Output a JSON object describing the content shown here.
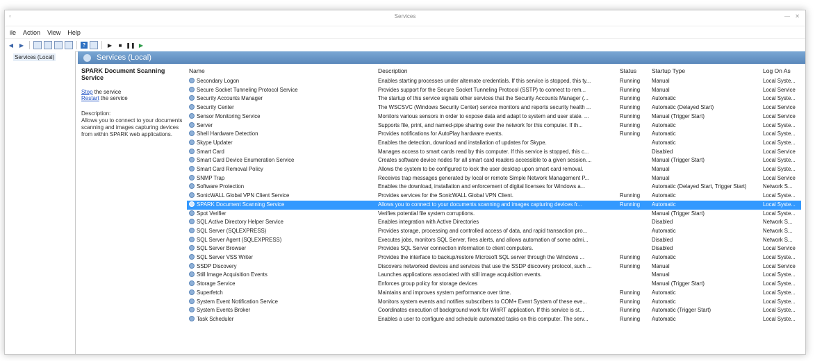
{
  "window": {
    "title": "Services"
  },
  "menu": [
    "ile",
    "Action",
    "View",
    "Help"
  ],
  "tree": {
    "root": "Services (Local)"
  },
  "header": {
    "title": "Services (Local)"
  },
  "extended": {
    "service_name": "SPARK Document Scanning Service",
    "stop_link": "Stop",
    "stop_rest": " the service",
    "restart_link": "Restart",
    "restart_rest": " the service",
    "description_label": "Description:",
    "description": "Allows you to connect to your documents scanning and images capturing devices from within SPARK web applications."
  },
  "columns": {
    "name": "Name",
    "description": "Description",
    "status": "Status",
    "startup": "Startup Type",
    "logon": "Log On As"
  },
  "services": [
    {
      "name": "Secondary Logon",
      "description": "Enables starting processes under alternate credentials. If this service is stopped, this ty...",
      "status": "Running",
      "startup": "Manual",
      "logon": "Local Syste..."
    },
    {
      "name": "Secure Socket Tunneling Protocol Service",
      "description": "Provides support for the Secure Socket Tunneling Protocol (SSTP) to connect to rem...",
      "status": "Running",
      "startup": "Manual",
      "logon": "Local Service"
    },
    {
      "name": "Security Accounts Manager",
      "description": "The startup of this service signals other services that the Security Accounts Manager (...",
      "status": "Running",
      "startup": "Automatic",
      "logon": "Local Syste..."
    },
    {
      "name": "Security Center",
      "description": "The WSCSVC (Windows Security Center) service monitors and reports security health ...",
      "status": "Running",
      "startup": "Automatic (Delayed Start)",
      "logon": "Local Service"
    },
    {
      "name": "Sensor Monitoring Service",
      "description": "Monitors various sensors in order to expose data and adapt to system and user state. ...",
      "status": "Running",
      "startup": "Manual (Trigger Start)",
      "logon": "Local Service"
    },
    {
      "name": "Server",
      "description": "Supports file, print, and named-pipe sharing over the network for this computer. If th...",
      "status": "Running",
      "startup": "Automatic",
      "logon": "Local Syste..."
    },
    {
      "name": "Shell Hardware Detection",
      "description": "Provides notifications for AutoPlay hardware events.",
      "status": "Running",
      "startup": "Automatic",
      "logon": "Local Syste..."
    },
    {
      "name": "Skype Updater",
      "description": "Enables the detection, download and installation of updates for Skype.",
      "status": "",
      "startup": "Automatic",
      "logon": "Local Syste..."
    },
    {
      "name": "Smart Card",
      "description": "Manages access to smart cards read by this computer. If this service is stopped, this c...",
      "status": "",
      "startup": "Disabled",
      "logon": "Local Service"
    },
    {
      "name": "Smart Card Device Enumeration Service",
      "description": "Creates software device nodes for all smart card readers accessible to a given session....",
      "status": "",
      "startup": "Manual (Trigger Start)",
      "logon": "Local Syste..."
    },
    {
      "name": "Smart Card Removal Policy",
      "description": "Allows the system to be configured to lock the user desktop upon smart card removal.",
      "status": "",
      "startup": "Manual",
      "logon": "Local Syste..."
    },
    {
      "name": "SNMP Trap",
      "description": "Receives trap messages generated by local or remote Simple Network Management P...",
      "status": "",
      "startup": "Manual",
      "logon": "Local Service"
    },
    {
      "name": "Software Protection",
      "description": "Enables the download, installation and enforcement of digital licenses for Windows a...",
      "status": "",
      "startup": "Automatic (Delayed Start, Trigger Start)",
      "logon": "Network S..."
    },
    {
      "name": "SonicWALL Global VPN Client Service",
      "description": "Provides services for the SonicWALL Global VPN Client.",
      "status": "Running",
      "startup": "Automatic",
      "logon": "Local Syste..."
    },
    {
      "name": "SPARK Document Scanning Service",
      "description": "Allows you to connect to your documents scanning and images capturing devices fr...",
      "status": "Running",
      "startup": "Automatic",
      "logon": "Local Syste...",
      "selected": true
    },
    {
      "name": "Spot Verifier",
      "description": "Verifies potential file system corruptions.",
      "status": "",
      "startup": "Manual (Trigger Start)",
      "logon": "Local Syste..."
    },
    {
      "name": "SQL Active Directory Helper Service",
      "description": "Enables integration with Active Directories",
      "status": "",
      "startup": "Disabled",
      "logon": "Network S..."
    },
    {
      "name": "SQL Server (SQLEXPRESS)",
      "description": "Provides storage, processing and controlled access of data, and rapid transaction pro...",
      "status": "",
      "startup": "Automatic",
      "logon": "Network S..."
    },
    {
      "name": "SQL Server Agent (SQLEXPRESS)",
      "description": "Executes jobs, monitors SQL Server, fires alerts, and allows automation of some admi...",
      "status": "",
      "startup": "Disabled",
      "logon": "Network S..."
    },
    {
      "name": "SQL Server Browser",
      "description": "Provides SQL Server connection information to client computers.",
      "status": "",
      "startup": "Disabled",
      "logon": "Local Service"
    },
    {
      "name": "SQL Server VSS Writer",
      "description": "Provides the interface to backup/restore Microsoft SQL server through the Windows ...",
      "status": "Running",
      "startup": "Automatic",
      "logon": "Local Syste..."
    },
    {
      "name": "SSDP Discovery",
      "description": "Discovers networked devices and services that use the SSDP discovery protocol, such ...",
      "status": "Running",
      "startup": "Manual",
      "logon": "Local Service"
    },
    {
      "name": "Still Image Acquisition Events",
      "description": "Launches applications associated with still image acquisition events.",
      "status": "",
      "startup": "Manual",
      "logon": "Local Syste..."
    },
    {
      "name": "Storage Service",
      "description": "Enforces group policy for storage devices",
      "status": "",
      "startup": "Manual (Trigger Start)",
      "logon": "Local Syste..."
    },
    {
      "name": "Superfetch",
      "description": "Maintains and improves system performance over time.",
      "status": "Running",
      "startup": "Automatic",
      "logon": "Local Syste..."
    },
    {
      "name": "System Event Notification Service",
      "description": "Monitors system events and notifies subscribers to COM+ Event System of these eve...",
      "status": "Running",
      "startup": "Automatic",
      "logon": "Local Syste..."
    },
    {
      "name": "System Events Broker",
      "description": "Coordinates execution of background work for WinRT application. If this service is st...",
      "status": "Running",
      "startup": "Automatic (Trigger Start)",
      "logon": "Local Syste..."
    },
    {
      "name": "Task Scheduler",
      "description": "Enables a user to configure and schedule automated tasks on this computer. The serv...",
      "status": "Running",
      "startup": "Automatic",
      "logon": "Local Syste..."
    }
  ],
  "colors": {
    "selection": "#3399ff",
    "header": "#5a88bb",
    "link": "#1a4fc5"
  }
}
